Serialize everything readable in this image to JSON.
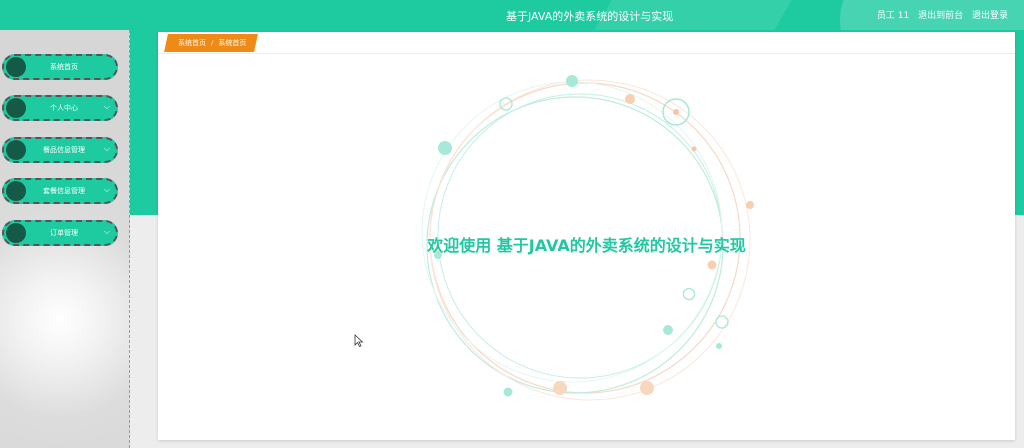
{
  "header": {
    "title": "基于JAVA的外卖系统的设计与实现",
    "user": "员工 11",
    "back_admin": "退出到前台",
    "logout": "退出登录"
  },
  "sidebar": {
    "items": [
      {
        "label": "系统首页",
        "has_chevron": false
      },
      {
        "label": "个人中心",
        "has_chevron": true
      },
      {
        "label": "餐品信息管理",
        "has_chevron": true
      },
      {
        "label": "套餐信息管理",
        "has_chevron": true
      },
      {
        "label": "订单管理",
        "has_chevron": true
      }
    ]
  },
  "breadcrumb": {
    "home": "系统首页",
    "separator": "/",
    "current": "系统首页"
  },
  "main": {
    "welcome": "欢迎使用 基于JAVA的外卖系统的设计与实现"
  },
  "colors": {
    "accent": "#1ecba1",
    "breadcrumb": "#ef8a16",
    "welcome_text": "#22c7a3"
  }
}
